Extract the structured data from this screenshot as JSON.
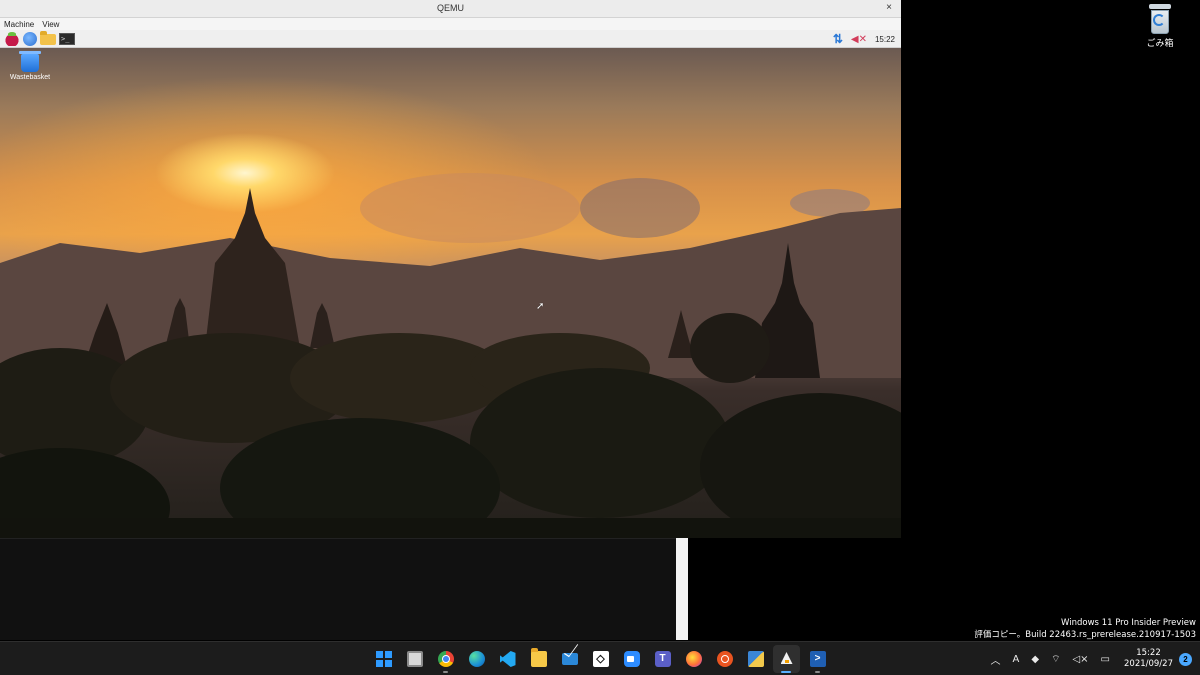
{
  "host": {
    "recycle_bin_label": "ごみ箱",
    "watermark_line1": "Windows 11 Pro Insider Preview",
    "watermark_line2": "評価コピー。Build 22463.rs_prerelease.210917-1503",
    "clock_time": "15:22",
    "clock_date": "2021/09/27",
    "notification_count": "2",
    "tray_ime": "A"
  },
  "qemu": {
    "title": "QEMU",
    "close_glyph": "×",
    "menu": [
      "Machine",
      "View"
    ],
    "guest_panel_time": "15:22",
    "terminal_glyph": ">_",
    "desktop_icon_label": "Wastebasket"
  },
  "taskbar": {
    "apps": [
      "start",
      "task-view",
      "chrome",
      "edge",
      "vscode",
      "file-explorer",
      "mail",
      "unity",
      "zoom",
      "teams",
      "firefox",
      "ubuntu",
      "vm-manager",
      "qemu",
      "powershell"
    ]
  },
  "colors": {
    "taskbar_bg": "#1c1c1c",
    "accent": "#2e9bff",
    "qemu_titlebar": "#ececec"
  }
}
